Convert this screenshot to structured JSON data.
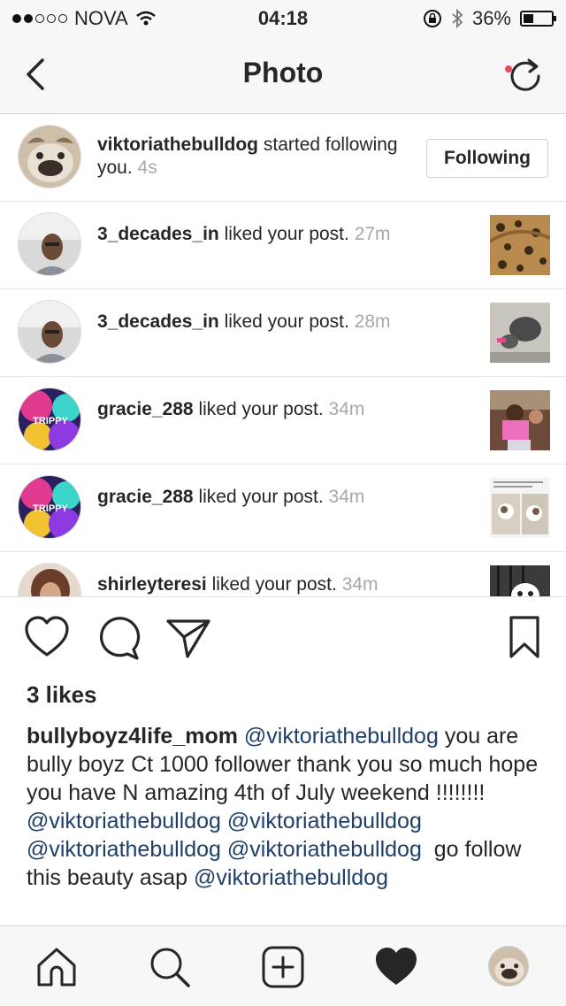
{
  "status_bar": {
    "carrier": "NOVA",
    "time": "04:18",
    "battery": "36%",
    "battery_level": 0.36
  },
  "header": {
    "title": "Photo"
  },
  "activity": [
    {
      "username": "viktoriathebulldog",
      "action": "started following you.",
      "time": "4s",
      "button": "Following"
    },
    {
      "username": "3_decades_in",
      "action": "liked your post.",
      "time": "27m"
    },
    {
      "username": "3_decades_in",
      "action": "liked your post.",
      "time": "28m"
    },
    {
      "username": "gracie_288",
      "action": "liked your post.",
      "time": "34m"
    },
    {
      "username": "gracie_288",
      "action": "liked your post.",
      "time": "34m"
    },
    {
      "username": "shirleyteresi",
      "action": "liked your post.",
      "time": "34m"
    }
  ],
  "avatar_badge": "TRIPPY",
  "post": {
    "likes": "3 likes",
    "caption_user": "bullyboyz4life_mom",
    "mention": "@viktoriathebulldog",
    "caption_text_1": "you are bully boyz Ct 1000 follower thank you so much hope you have N amazing 4th of July weekend !!!!!!!!",
    "caption_text_2": "go follow this beauty asap"
  },
  "icons": {
    "back": "chevron-left-icon",
    "refresh": "refresh-icon",
    "like": "heart-outline-icon",
    "comment": "comment-icon",
    "share": "send-icon",
    "save": "bookmark-icon",
    "home": "home-icon",
    "search": "search-icon",
    "add": "add-post-icon",
    "activity": "heart-filled-icon"
  },
  "colors": {
    "mention": "#1f3f6b",
    "timestamp": "#a8a8a8",
    "notification_dot": "#ed4956"
  }
}
